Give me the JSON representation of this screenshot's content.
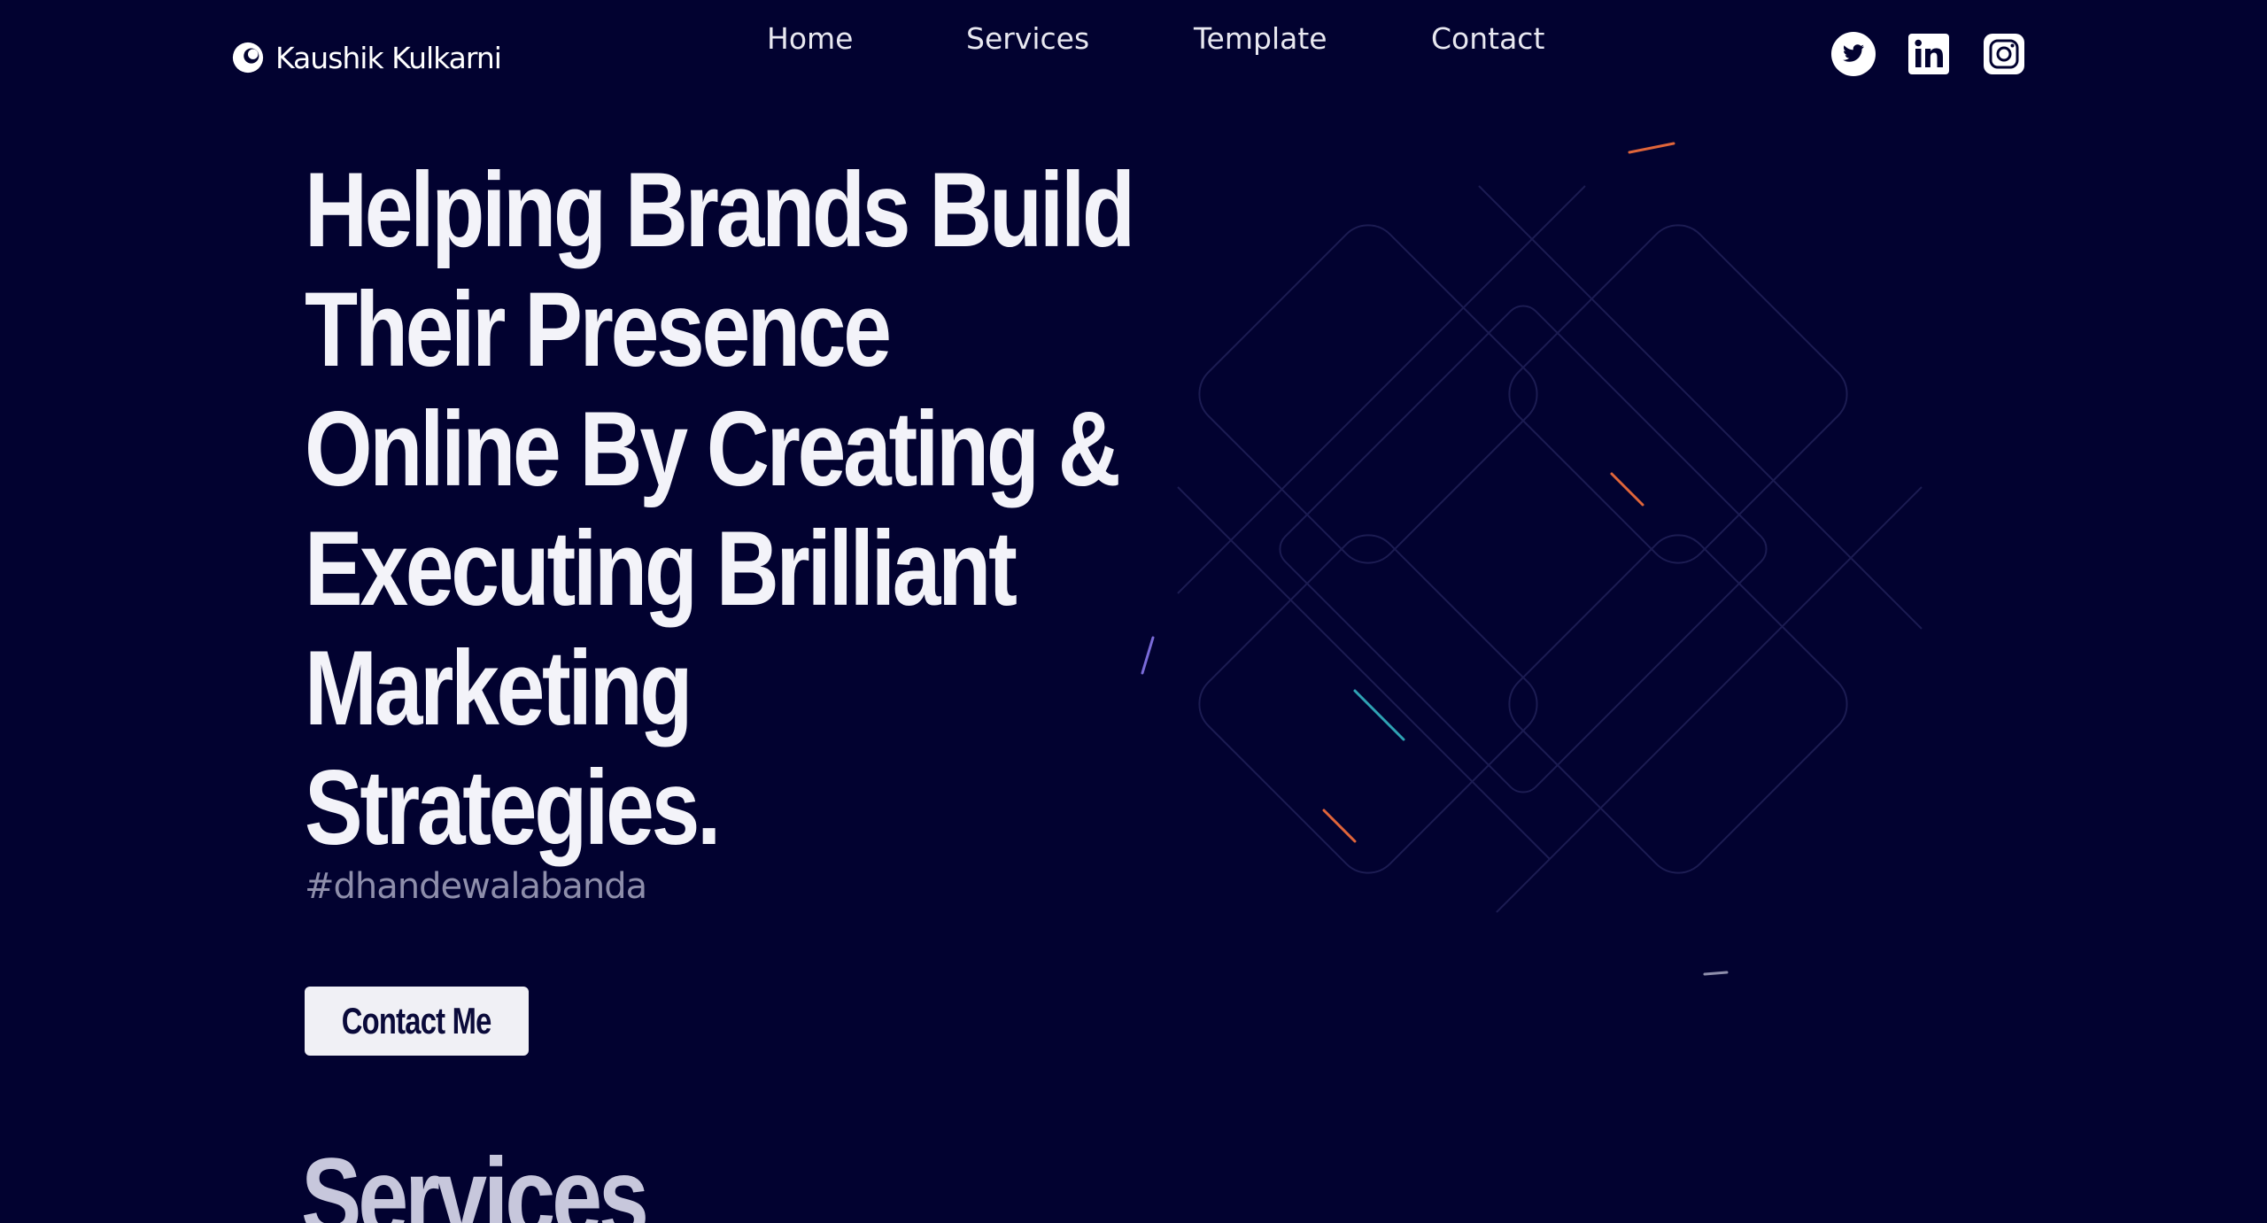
{
  "header": {
    "logo_text": "Kaushik Kulkarni",
    "nav": [
      {
        "label": "Home"
      },
      {
        "label": "Services"
      },
      {
        "label": "Template"
      },
      {
        "label": "Contact"
      }
    ],
    "social": [
      {
        "icon": "twitter-icon"
      },
      {
        "icon": "linkedin-icon"
      },
      {
        "icon": "instagram-icon"
      }
    ]
  },
  "hero": {
    "title_lines": [
      "Helping Brands Build",
      "Their Presence",
      "Online By Creating &",
      "Executing Brilliant",
      "Marketing",
      "Strategies."
    ],
    "hashtag": "#dhandewalabanda",
    "cta_label": "Contact Me"
  },
  "services": {
    "title": "Services"
  },
  "colors": {
    "background": "#020230",
    "text": "#f3f3f9",
    "muted": "#8e8eab",
    "accent_orange": "#e0653a",
    "accent_teal": "#2fa3b5"
  }
}
